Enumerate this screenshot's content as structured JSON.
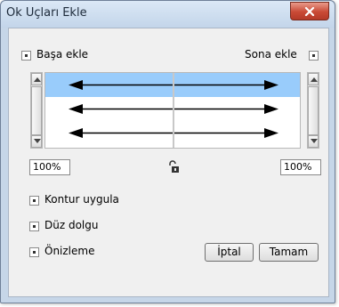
{
  "window": {
    "title": "Ok Uçları Ekle"
  },
  "options": {
    "start_label": "Başa ekle",
    "end_label": "Sona ekle",
    "stroke_label": "Kontur uygula",
    "solid_fill_label": "Düz dolgu",
    "preview_label": "Önizleme"
  },
  "scale": {
    "start_value": "100%",
    "end_value": "100%",
    "link_icon": "unlink-icon"
  },
  "buttons": {
    "cancel_label": "İptal",
    "ok_label": "Tamam"
  },
  "colors": {
    "selection": "#99ccfb",
    "close": "#c94a36"
  }
}
